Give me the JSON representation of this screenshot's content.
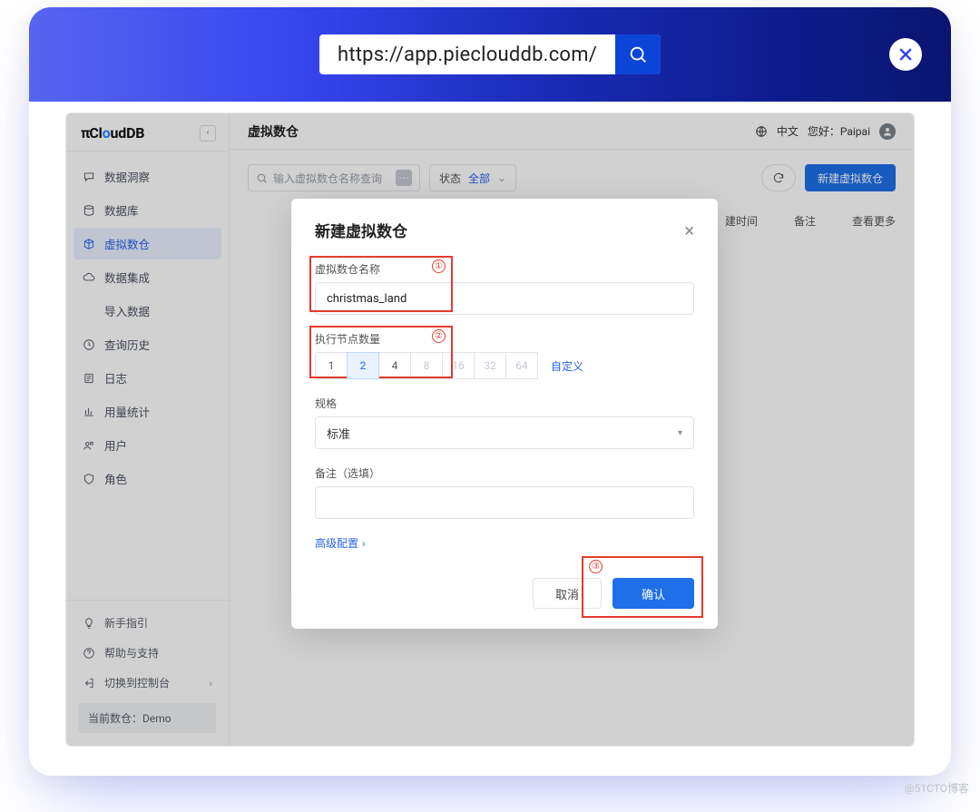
{
  "url": "https://app.pieclouddb.com/",
  "logo": {
    "pre": "π",
    "text1": "Cl",
    "o": "o",
    "text2": "udDB"
  },
  "sidebar": {
    "items": [
      {
        "label": "数据洞察"
      },
      {
        "label": "数据库"
      },
      {
        "label": "虚拟数仓"
      },
      {
        "label": "数据集成"
      },
      {
        "label": "导入数据"
      },
      {
        "label": "查询历史"
      },
      {
        "label": "日志"
      },
      {
        "label": "用量统计"
      },
      {
        "label": "用户"
      },
      {
        "label": "角色"
      }
    ],
    "bottom": [
      {
        "label": "新手指引"
      },
      {
        "label": "帮助与支持"
      },
      {
        "label": "切换到控制台"
      }
    ],
    "current_db_label": "当前数仓：",
    "current_db_value": "Demo"
  },
  "header": {
    "title": "虚拟数仓",
    "lang": "中文",
    "greeting_prefix": "您好：",
    "user": "Paipai"
  },
  "toolbar": {
    "search_placeholder": "输入虚拟数仓名称查询",
    "status_label": "状态",
    "status_value": "全部",
    "new_label": "新建虚拟数仓"
  },
  "table_head": [
    "建时间",
    "备注",
    "查看更多"
  ],
  "modal": {
    "title": "新建虚拟数仓",
    "name_label": "虚拟数仓名称",
    "name_value": "christmas_land",
    "nodes_label": "执行节点数量",
    "node_options": [
      "1",
      "2",
      "4",
      "8",
      "16",
      "32",
      "64"
    ],
    "node_selected": "2",
    "node_disabled": [
      "8",
      "16",
      "32",
      "64"
    ],
    "custom_label": "自定义",
    "spec_label": "规格",
    "spec_value": "标准",
    "remark_label": "备注（选填）",
    "advanced_label": "高级配置",
    "cancel": "取消",
    "confirm": "确认",
    "marks": {
      "1": "①",
      "2": "②",
      "3": "③"
    }
  },
  "watermark": "@51CTO博客"
}
